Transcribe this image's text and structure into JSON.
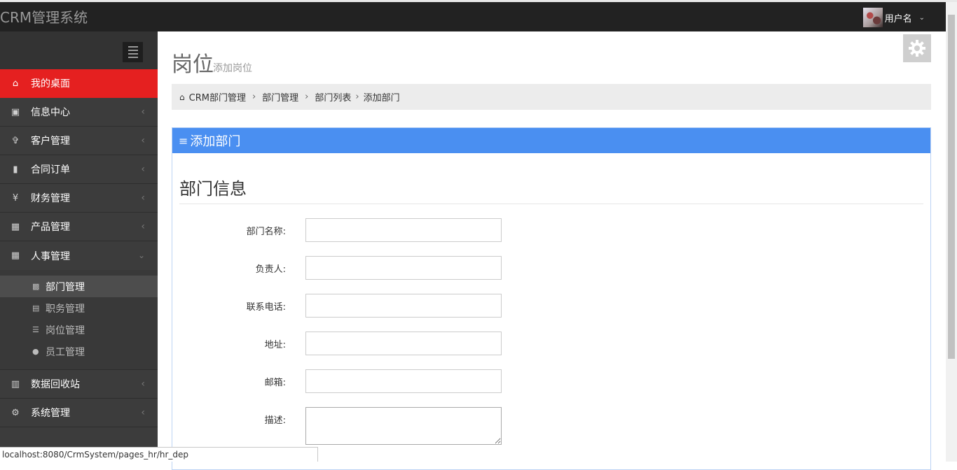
{
  "app": {
    "brand": "CRM管理系统",
    "username": "用户名"
  },
  "sidebar": {
    "items": [
      {
        "label": "我的桌面",
        "icon": "home-icon"
      },
      {
        "label": "信息中心",
        "icon": "youtube-icon"
      },
      {
        "label": "客户管理",
        "icon": "male-icon"
      },
      {
        "label": "合同订单",
        "icon": "book-icon"
      },
      {
        "label": "财务管理",
        "icon": "yen-icon"
      },
      {
        "label": "产品管理",
        "icon": "table-icon"
      },
      {
        "label": "人事管理",
        "icon": "table-icon"
      },
      {
        "label": "数据回收站",
        "icon": "trash-icon"
      },
      {
        "label": "系统管理",
        "icon": "gear-icon"
      }
    ],
    "sub_items": [
      {
        "label": "部门管理",
        "icon": "gamepad-icon"
      },
      {
        "label": "职务管理",
        "icon": "clipboard-icon"
      },
      {
        "label": "岗位管理",
        "icon": "indent-icon"
      },
      {
        "label": "员工管理",
        "icon": "users-icon"
      }
    ]
  },
  "page": {
    "title": "岗位",
    "subtitle": "添加岗位"
  },
  "breadcrumb": [
    "CRM部门管理",
    "部门管理",
    "部门列表",
    "添加部门"
  ],
  "panel": {
    "title": "添加部门",
    "section_title": "部门信息"
  },
  "form": {
    "fields": [
      {
        "label": "部门名称:",
        "value": ""
      },
      {
        "label": "负责人:",
        "value": ""
      },
      {
        "label": "联系电话:",
        "value": ""
      },
      {
        "label": "地址:",
        "value": ""
      },
      {
        "label": "邮箱:",
        "value": ""
      },
      {
        "label": "描述:",
        "value": ""
      }
    ]
  },
  "statusbar": {
    "url": "localhost:8080/CrmSystem/pages_hr/hr_dep"
  },
  "colors": {
    "accent_red": "#e52020",
    "panel_blue": "#4a8ff1",
    "topbar": "#222222"
  }
}
